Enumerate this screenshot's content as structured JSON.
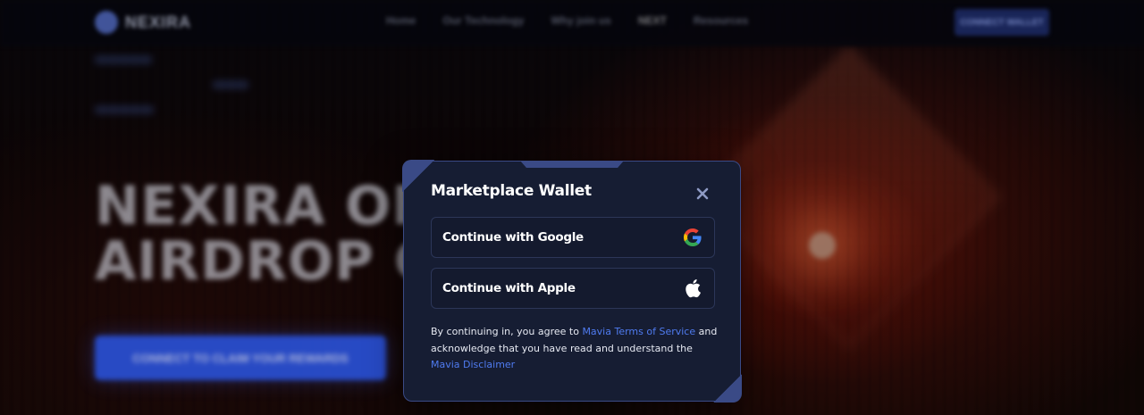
{
  "background": {
    "brand": "NEXIRA",
    "nav_links": [
      "Home",
      "Our Technology",
      "Why join us",
      "NEXT",
      "Resources"
    ],
    "nav_cta": "CONNECT WALLET",
    "hero_line1": "NEXIRA OFFICIAL",
    "hero_line2": "AIRDROP CAMPAIGN",
    "hero_cta": "CONNECT TO CLAIM YOUR REWARDS"
  },
  "modal": {
    "title": "Marketplace Wallet",
    "options": [
      {
        "label": "Continue with Google",
        "icon": "google-icon"
      },
      {
        "label": "Continue with Apple",
        "icon": "apple-icon"
      }
    ],
    "legal": {
      "part1": "By continuing in, you agree to ",
      "terms_link": "Mavia Terms of Service",
      "part2": " and acknowledge that you have read and understand the ",
      "disclaimer_link": "Mavia Disclaimer"
    }
  },
  "colors": {
    "modal_bg": "#161d33",
    "modal_border": "#3a4a86",
    "link": "#4f7bf0",
    "close_icon": "#8e9ac4"
  }
}
